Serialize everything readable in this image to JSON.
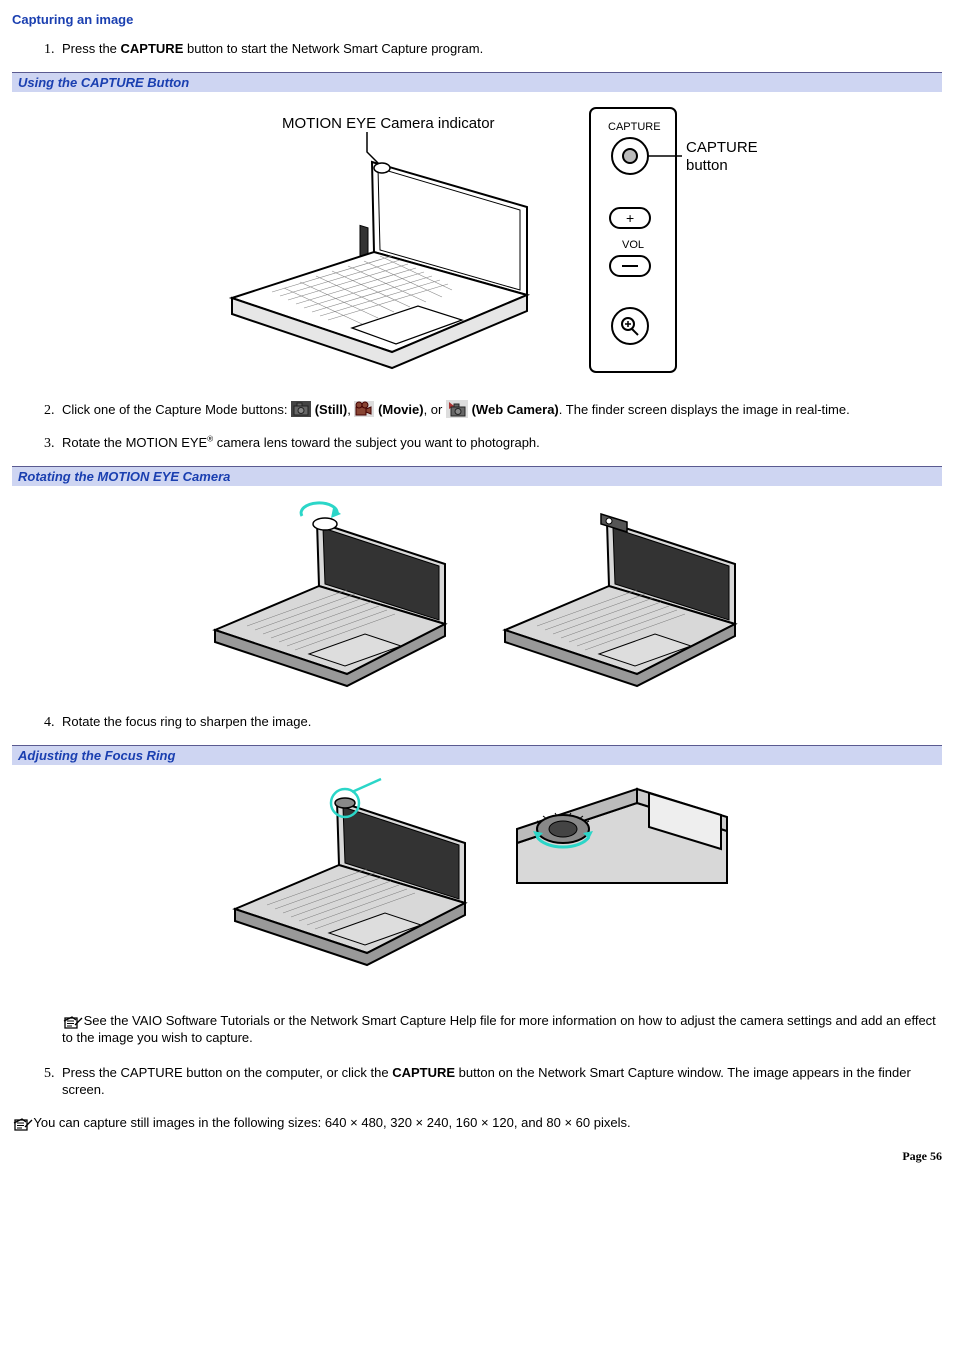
{
  "title": "Capturing an image",
  "steps": {
    "s1_a": "Press the ",
    "s1_b": "CAPTURE",
    "s1_c": " button to start the Network Smart Capture program.",
    "s2_a": "Click one of the Capture Mode buttons: ",
    "s2_still": "(Still)",
    "s2_sep1": ", ",
    "s2_movie": "(Movie)",
    "s2_sep2": ", or ",
    "s2_web": "(Web Camera)",
    "s2_tail": ". The finder screen displays the image in real-time.",
    "s3_a": "Rotate the MOTION EYE",
    "s3_b": " camera lens toward the subject you want to photograph.",
    "s4": "Rotate the focus ring to sharpen the image.",
    "s4_note": " See the VAIO Software Tutorials or the Network Smart Capture Help file for more information on how to adjust the camera settings and add an effect to the image you wish to capture.",
    "s5_a": "Press the CAPTURE button on the computer, or click the ",
    "s5_b": "CAPTURE",
    "s5_c": " button on the Network Smart Capture window. The image appears in the finder screen."
  },
  "captions": {
    "c1": "Using the CAPTURE Button",
    "c2": "Rotating the MOTION EYE Camera",
    "c3": "Adjusting the Focus Ring"
  },
  "fig1": {
    "indicator_label": "MOTION EYE Camera indicator",
    "capture_top": "CAPTURE",
    "capture_label_1": "CAPTURE",
    "capture_label_2": "button",
    "vol_label": "VOL"
  },
  "bottom_note": " You can capture still images in the following sizes: 640 × 480, 320 × 240, 160 × 120, and 80 × 60 pixels.",
  "page": "Page 56"
}
